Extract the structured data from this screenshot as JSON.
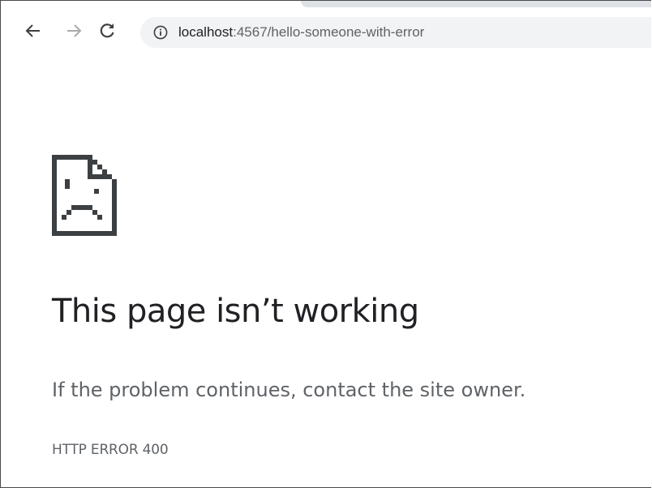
{
  "toolbar": {
    "back_icon": "arrow-left-icon",
    "forward_icon": "arrow-right-icon",
    "reload_icon": "reload-icon",
    "site_info_icon": "info-circle-icon",
    "url_host": "localhost",
    "url_rest": ":4567/hello-someone-with-error"
  },
  "error_page": {
    "icon": "sad-page-icon",
    "headline": "This page isn’t working",
    "message": "If the problem continues, contact the site owner.",
    "error_code": "HTTP ERROR 400"
  },
  "colors": {
    "headline": "#202124",
    "secondary_text": "#5f6368",
    "omnibox_bg": "#f1f3f4",
    "icon": "#3c4043"
  }
}
